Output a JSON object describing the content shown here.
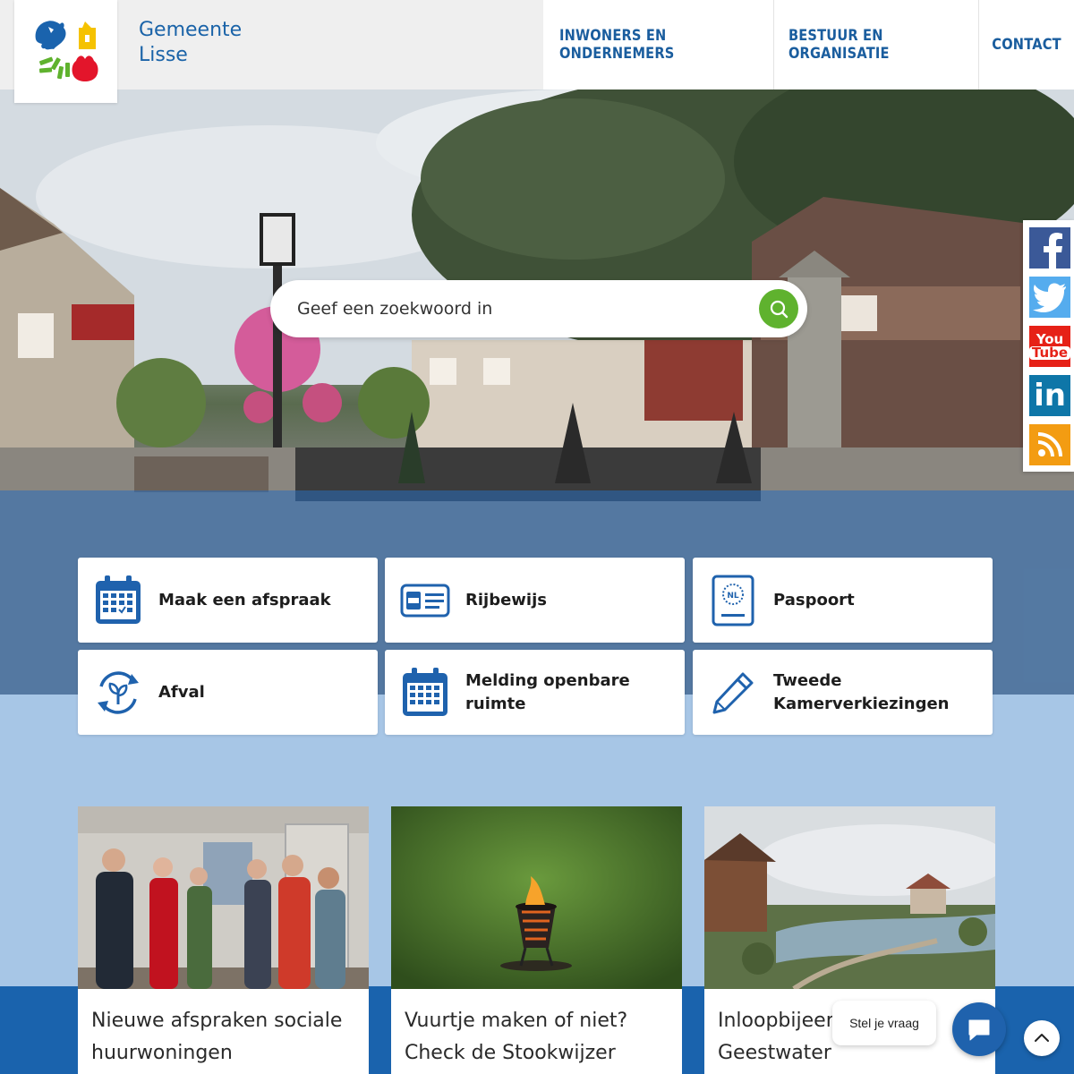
{
  "header": {
    "brand_line1": "Gemeente",
    "brand_line2": "Lisse",
    "nav": [
      {
        "label": "INWONERS EN ONDERNEMERS"
      },
      {
        "label": "BESTUUR EN ORGANISATIE"
      },
      {
        "label": "CONTACT"
      }
    ]
  },
  "search": {
    "placeholder": "Geef een zoekwoord in"
  },
  "social": [
    {
      "icon": "facebook-icon",
      "color": "#3b5998"
    },
    {
      "icon": "twitter-icon",
      "color": "#55acee"
    },
    {
      "icon": "youtube-icon",
      "color": "#e62117"
    },
    {
      "icon": "linkedin-icon",
      "color": "#0e76a8"
    },
    {
      "icon": "rss-icon",
      "color": "#f39c12"
    }
  ],
  "tiles": [
    {
      "label": "Maak een afspraak",
      "icon": "calendar-icon"
    },
    {
      "label": "Rijbewijs",
      "icon": "drivers-license-icon"
    },
    {
      "label": "Paspoort",
      "icon": "passport-icon",
      "icon_text": "NL"
    },
    {
      "label": "Afval",
      "icon": "recycle-icon"
    },
    {
      "label": "Melding openbare ruimte",
      "icon": "calendar-icon"
    },
    {
      "label": "Tweede Kamerverkiezingen",
      "icon": "pencil-icon"
    }
  ],
  "news": [
    {
      "title": "Nieuwe afspraken sociale huurwoningen"
    },
    {
      "title": "Vuurtje maken of niet? Check de Stookwijzer"
    },
    {
      "title": "Inloopbijeenkomst Geestwater"
    }
  ],
  "chat": {
    "prompt": "Stel je vraag"
  },
  "colors": {
    "brand_blue": "#1a63a8",
    "accent_green": "#5fb22e",
    "light_blue": "#a7c6e6"
  }
}
